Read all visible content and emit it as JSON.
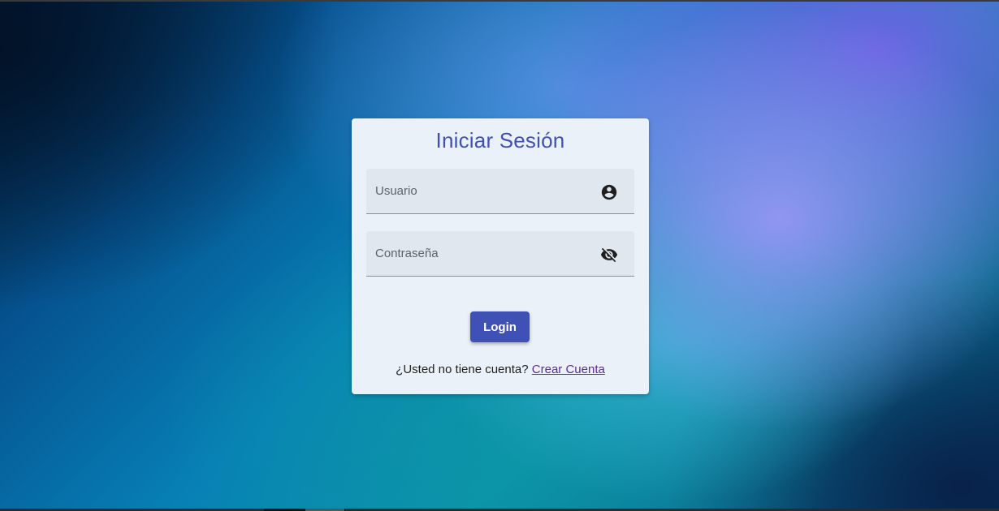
{
  "login": {
    "title": "Iniciar Sesión",
    "username": {
      "value": "",
      "placeholder": "Usuario",
      "icon": "account-circle-icon"
    },
    "password": {
      "value": "",
      "placeholder": "Contraseña",
      "icon": "eye-off-icon"
    },
    "submit_label": "Login",
    "signup_prompt": "¿Usted no tiene cuenta?",
    "signup_link": "Crear Cuenta"
  },
  "colors": {
    "primary": "#3f51b5",
    "card_background": "#ebf1f8",
    "field_background": "#e1e7ee",
    "link": "#5a2d91"
  }
}
